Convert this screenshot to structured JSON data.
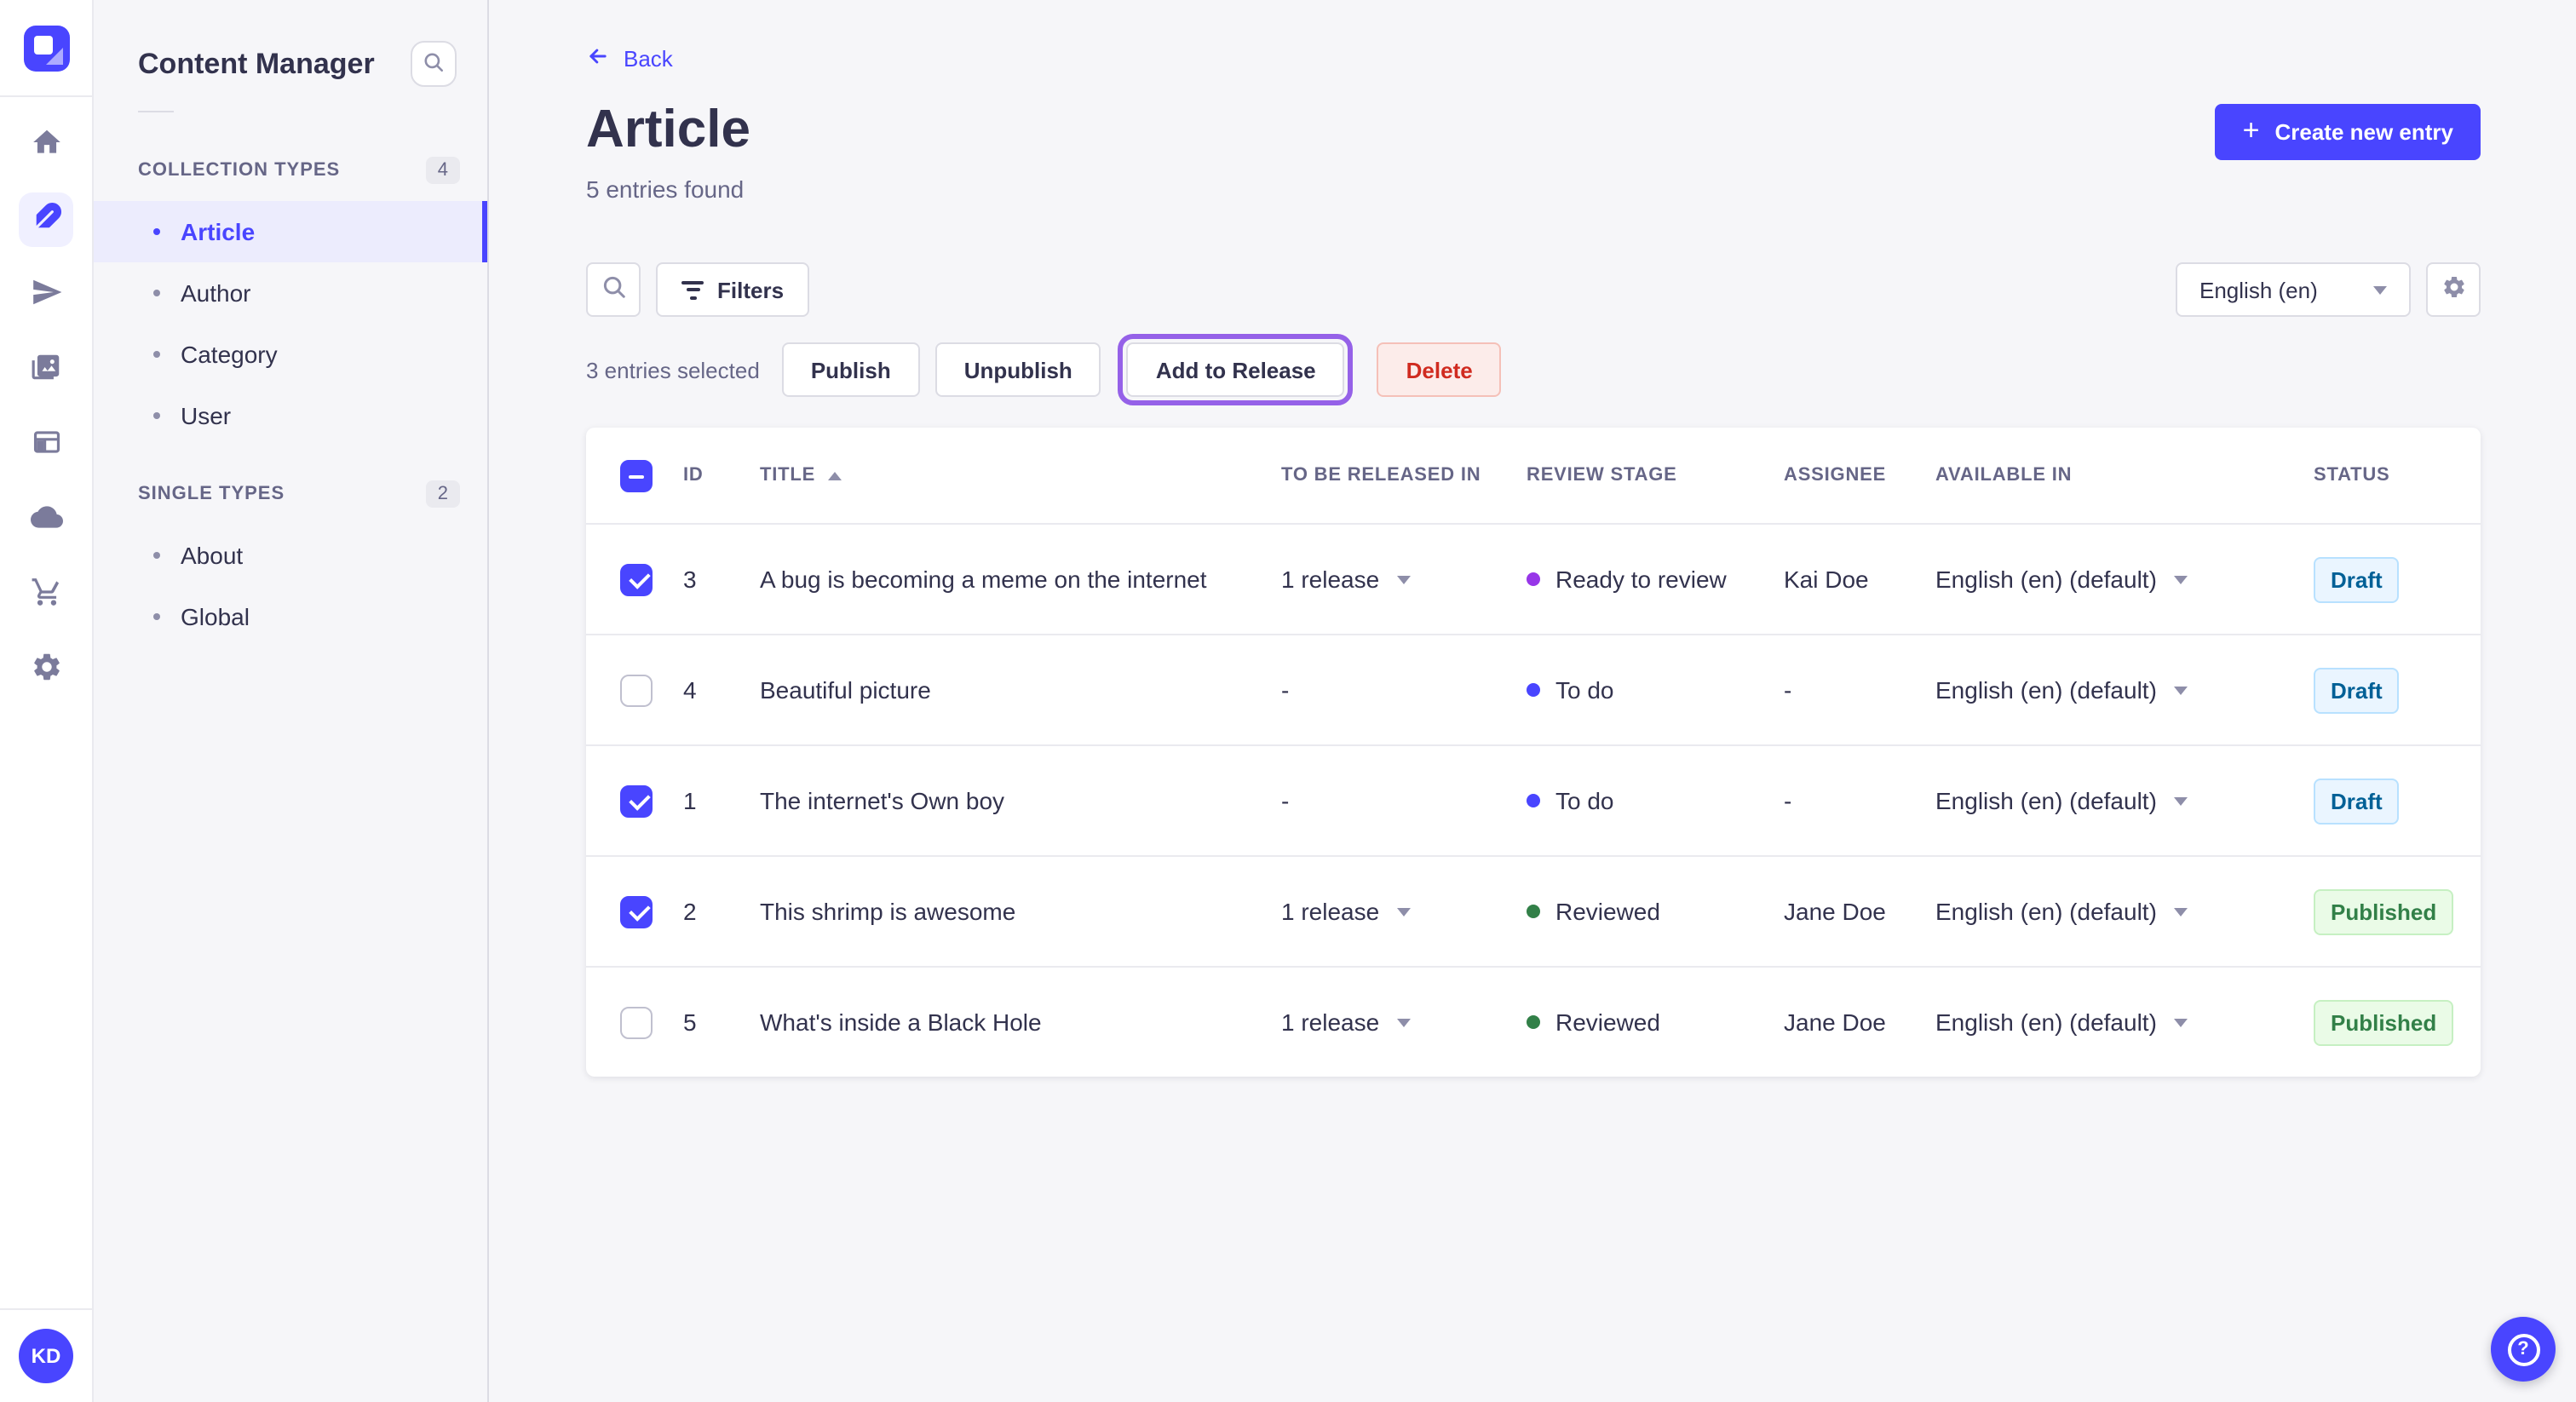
{
  "colors": {
    "primary": "#4945FF",
    "highlight_ring": "#9561E8",
    "status_styles": {
      "Draft": {
        "bg": "#EAF5FF",
        "border": "#B8E1FF",
        "text": "#006096"
      },
      "Published": {
        "bg": "#EAFBE7",
        "border": "#C6F0C2",
        "text": "#328048"
      }
    }
  },
  "subnav": {
    "title": "Content Manager",
    "sections": [
      {
        "label": "COLLECTION TYPES",
        "count": "4",
        "items": [
          {
            "label": "Article",
            "active": true
          },
          {
            "label": "Author",
            "active": false
          },
          {
            "label": "Category",
            "active": false
          },
          {
            "label": "User",
            "active": false
          }
        ]
      },
      {
        "label": "SINGLE TYPES",
        "count": "2",
        "items": [
          {
            "label": "About",
            "active": false
          },
          {
            "label": "Global",
            "active": false
          }
        ]
      }
    ]
  },
  "header": {
    "back_label": "Back",
    "title": "Article",
    "subtitle": "5 entries found",
    "create_button": "Create new entry"
  },
  "toolbar": {
    "filters_label": "Filters",
    "locale_value": "English (en)"
  },
  "selection": {
    "summary": "3 entries selected",
    "publish": "Publish",
    "unpublish": "Unpublish",
    "add_to_release": "Add to Release",
    "delete": "Delete"
  },
  "table": {
    "headers": [
      "ID",
      "TITLE",
      "TO BE RELEASED IN",
      "REVIEW STAGE",
      "ASSIGNEE",
      "AVAILABLE IN",
      "STATUS"
    ],
    "rows": [
      {
        "checked": true,
        "id": "3",
        "title": "A bug is becoming a meme on the internet",
        "release": "1 release",
        "stage": "Ready to review",
        "stage_color": "#9736E8",
        "assignee": "Kai Doe",
        "locale": "English (en) (default)",
        "status": "Draft"
      },
      {
        "checked": false,
        "id": "4",
        "title": "Beautiful picture",
        "release": "-",
        "stage": "To do",
        "stage_color": "#4945FF",
        "assignee": "-",
        "locale": "English (en) (default)",
        "status": "Draft"
      },
      {
        "checked": true,
        "id": "1",
        "title": "The internet's Own boy",
        "release": "-",
        "stage": "To do",
        "stage_color": "#4945FF",
        "assignee": "-",
        "locale": "English (en) (default)",
        "status": "Draft"
      },
      {
        "checked": true,
        "id": "2",
        "title": "This shrimp is awesome",
        "release": "1 release",
        "stage": "Reviewed",
        "stage_color": "#328048",
        "assignee": "Jane Doe",
        "locale": "English (en) (default)",
        "status": "Published"
      },
      {
        "checked": false,
        "id": "5",
        "title": "What's inside a Black Hole",
        "release": "1 release",
        "stage": "Reviewed",
        "stage_color": "#328048",
        "assignee": "Jane Doe",
        "locale": "English (en) (default)",
        "status": "Published"
      }
    ]
  },
  "user": {
    "initials": "KD"
  },
  "help": {
    "label": "?"
  }
}
